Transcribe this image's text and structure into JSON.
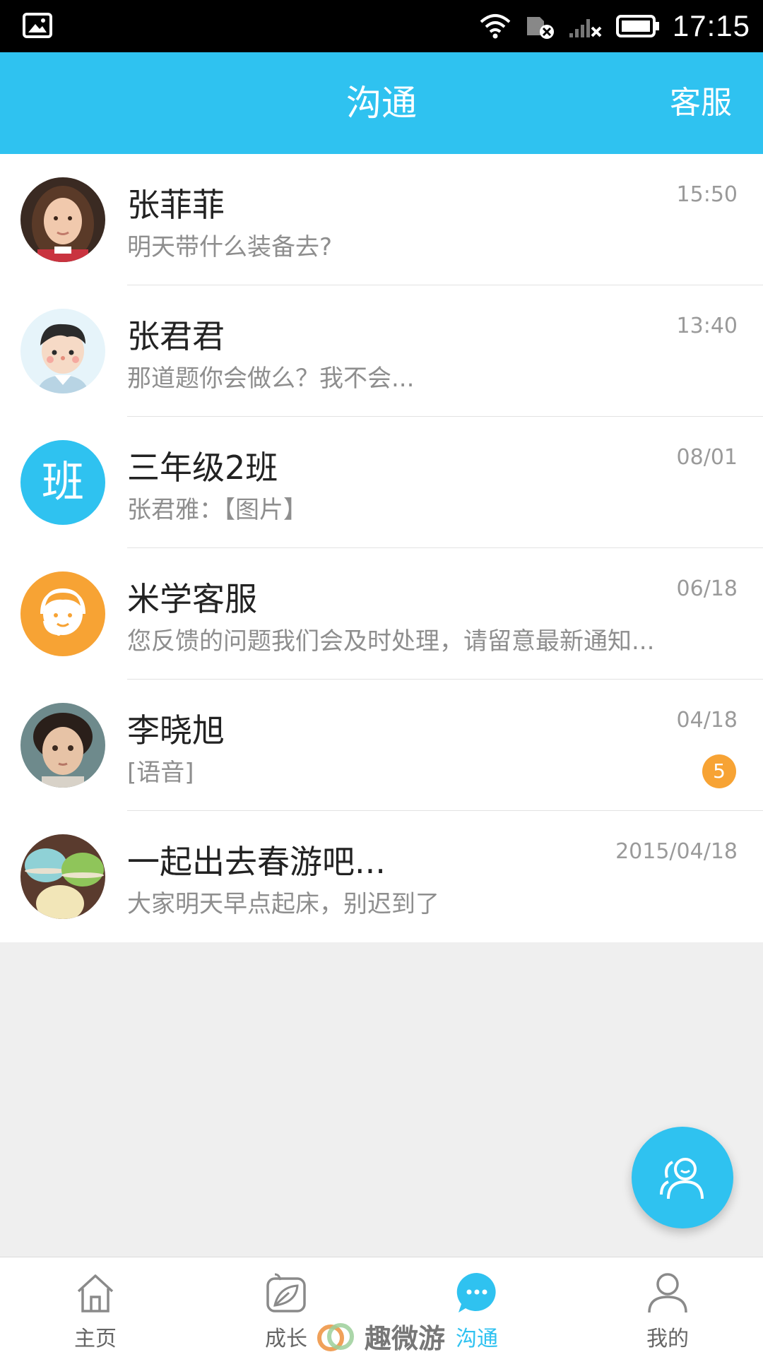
{
  "status_bar": {
    "time": "17:15"
  },
  "header": {
    "title": "沟通",
    "service_label": "客服"
  },
  "conversations": [
    {
      "name": "张菲菲",
      "message": "明天带什么装备去?",
      "time": "15:50",
      "avatar": "girl-photo"
    },
    {
      "name": "张君君",
      "message": "那道题你会做么？我不会...",
      "time": "13:40",
      "avatar": "cartoon-boy"
    },
    {
      "name": "三年级2班",
      "message": "张君雅：【图片】",
      "time": "08/01",
      "avatar": "class-icon",
      "avatar_text": "班"
    },
    {
      "name": "米学客服",
      "message": "您反馈的问题我们会及时处理，请留意最新通知...",
      "time": "06/18",
      "avatar": "customer-service-icon"
    },
    {
      "name": "李晓旭",
      "message": "[语音]",
      "time": "04/18",
      "avatar": "boy-photo",
      "unread": "5"
    },
    {
      "name": "一起出去春游吧...",
      "message": "大家明天早点起床，别迟到了",
      "time": "2015/04/18",
      "avatar": "macarons-photo"
    }
  ],
  "tabs": [
    {
      "label": "主页",
      "icon": "home-icon"
    },
    {
      "label": "成长",
      "icon": "growth-leaf-icon"
    },
    {
      "label": "沟通",
      "icon": "chat-bubble-icon",
      "active": true
    },
    {
      "label": "我的",
      "icon": "profile-icon"
    }
  ],
  "watermark": {
    "text": "趣微游"
  },
  "colors": {
    "accent": "#2fc2f0",
    "badge": "#f7a334",
    "service_avatar": "#f7a334",
    "background": "#efefef"
  }
}
